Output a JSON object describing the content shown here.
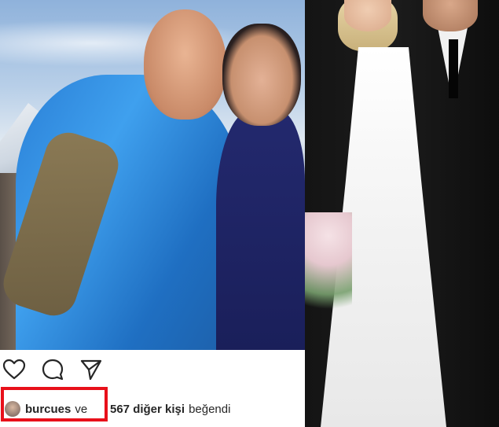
{
  "post": {
    "liked_by_user": "burcues",
    "liked_by_and": "ve",
    "others_count": "567 diğer kişi",
    "liked_suffix": "beğendi"
  },
  "icons": {
    "like": "heart-icon",
    "comment": "comment-icon",
    "share": "send-icon"
  },
  "colors": {
    "highlight": "#e8101a",
    "text": "#262626"
  }
}
